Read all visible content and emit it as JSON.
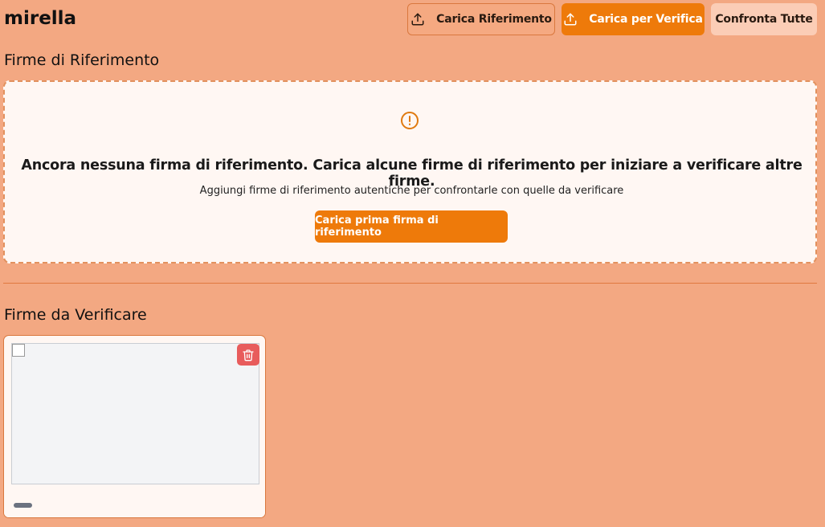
{
  "app": {
    "title": "mirella"
  },
  "toolbar": {
    "upload_reference_label": "Carica Riferimento",
    "upload_verify_label": "Carica per Verifica",
    "compare_all_label": "Confronta Tutte"
  },
  "reference_section": {
    "title": "Firme di Riferimento",
    "empty_title": "Ancora nessuna firma di riferimento. Carica alcune firme di riferimento per iniziare a verificare altre firme.",
    "empty_subtitle": "Aggiungi firme di riferimento autentiche per confrontarle con quelle da verificare",
    "first_upload_label": "Carica prima firma di riferimento"
  },
  "verify_section": {
    "title": "Firme da Verificare"
  },
  "icons": {
    "upload": "upload-icon",
    "alert": "alert-circle-icon",
    "delete": "trash-icon"
  },
  "colors": {
    "background": "#F3A882",
    "accent": "#EE7A0A",
    "danger": "#E85C5C",
    "panel": "#FFF7F3"
  }
}
